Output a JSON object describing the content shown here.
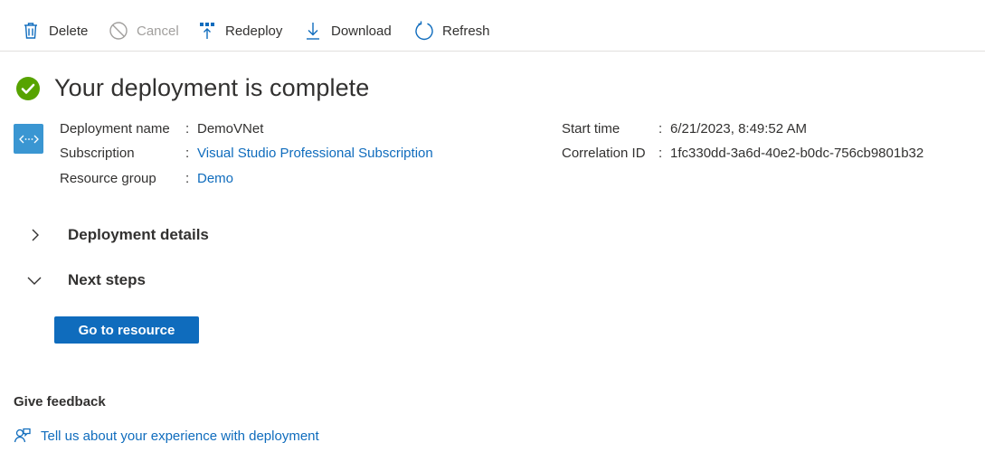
{
  "toolbar": {
    "delete_label": "Delete",
    "cancel_label": "Cancel",
    "redeploy_label": "Redeploy",
    "download_label": "Download",
    "refresh_label": "Refresh"
  },
  "header": {
    "title": "Your deployment is complete",
    "status_color": "#57a300"
  },
  "details": {
    "deployment_name_label": "Deployment name",
    "deployment_name_value": "DemoVNet",
    "subscription_label": "Subscription",
    "subscription_value": "Visual Studio Professional Subscription",
    "resource_group_label": "Resource group",
    "resource_group_value": "Demo",
    "start_time_label": "Start time",
    "start_time_value": "6/21/2023, 8:49:52 AM",
    "correlation_id_label": "Correlation ID",
    "correlation_id_value": "1fc330dd-3a6d-40e2-b0dc-756cb9801b32",
    "separator": ":"
  },
  "sections": {
    "deployment_details_label": "Deployment details",
    "next_steps_label": "Next steps"
  },
  "actions": {
    "go_to_resource_label": "Go to resource"
  },
  "feedback": {
    "title": "Give feedback",
    "link_label": "Tell us about your experience with deployment"
  },
  "colors": {
    "accent": "#0f6cbd",
    "resource_icon": "#3a96d2"
  }
}
